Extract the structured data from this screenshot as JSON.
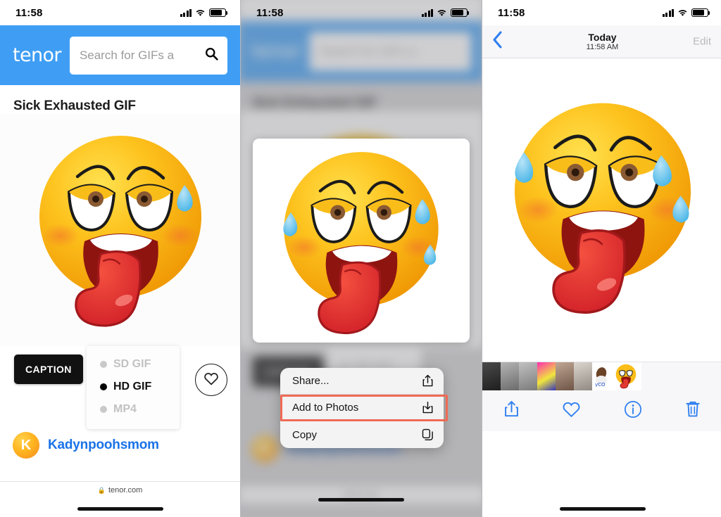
{
  "panel1": {
    "name": "tenor-gif-page",
    "statusbar": {
      "time": "11:58",
      "cell": "cell-signal-icon",
      "wifi": "wifi-icon",
      "battery": "battery-icon"
    },
    "header": {
      "logo": "tenor",
      "search_placeholder": "Search for GIFs a",
      "search_value": "",
      "search_icon": "search-icon",
      "brand_color": "#3f9ef4"
    },
    "gif_title": "Sick Exhausted GIF",
    "caption_button": "CAPTION",
    "formats": [
      {
        "label": "SD GIF",
        "selected": false
      },
      {
        "label": "HD GIF",
        "selected": true
      },
      {
        "label": "MP4",
        "selected": false
      }
    ],
    "favorite_icon": "heart-icon",
    "uploader": {
      "initial": "K",
      "name": "Kadynpoohsmom"
    },
    "url_bar": {
      "lock_icon": "lock-icon",
      "domain": "tenor.com"
    }
  },
  "panel2": {
    "name": "share-sheet-context-menu",
    "statusbar": {
      "time": "11:58"
    },
    "menu_items": [
      {
        "label": "Share...",
        "icon": "share-icon",
        "highlighted": false
      },
      {
        "label": "Add to Photos",
        "icon": "add-to-photos-icon",
        "highlighted": true
      },
      {
        "label": "Copy",
        "icon": "copy-icon",
        "highlighted": false
      }
    ],
    "highlight_color": "#ef6a55"
  },
  "panel3": {
    "name": "photos-app-viewer",
    "statusbar": {
      "time": "11:58"
    },
    "nav": {
      "back_icon": "chevron-left-icon",
      "title": "Today",
      "subtitle": "11:58 AM",
      "edit_label": "Edit"
    },
    "toolbar": [
      {
        "icon": "share-icon",
        "name": "share-button"
      },
      {
        "icon": "heart-icon",
        "name": "favorite-button"
      },
      {
        "icon": "info-icon",
        "name": "info-button"
      },
      {
        "icon": "trash-icon",
        "name": "delete-button"
      }
    ],
    "thumbnails": [
      {
        "name": "thumbnail-1",
        "color": "#3a3a3a"
      },
      {
        "name": "thumbnail-2",
        "color": "#8e8e8e"
      },
      {
        "name": "thumbnail-3",
        "color": "#9c9c9c"
      },
      {
        "name": "thumbnail-4",
        "color": "#e039b2"
      },
      {
        "name": "thumbnail-5",
        "color": "#9b8273"
      },
      {
        "name": "thumbnail-6",
        "color": "#b9b2ac"
      },
      {
        "name": "thumbnail-7",
        "color": "#ffffff"
      },
      {
        "name": "thumbnail-current",
        "color": "#ffffff"
      }
    ],
    "accent_color": "#2f7ff0"
  }
}
